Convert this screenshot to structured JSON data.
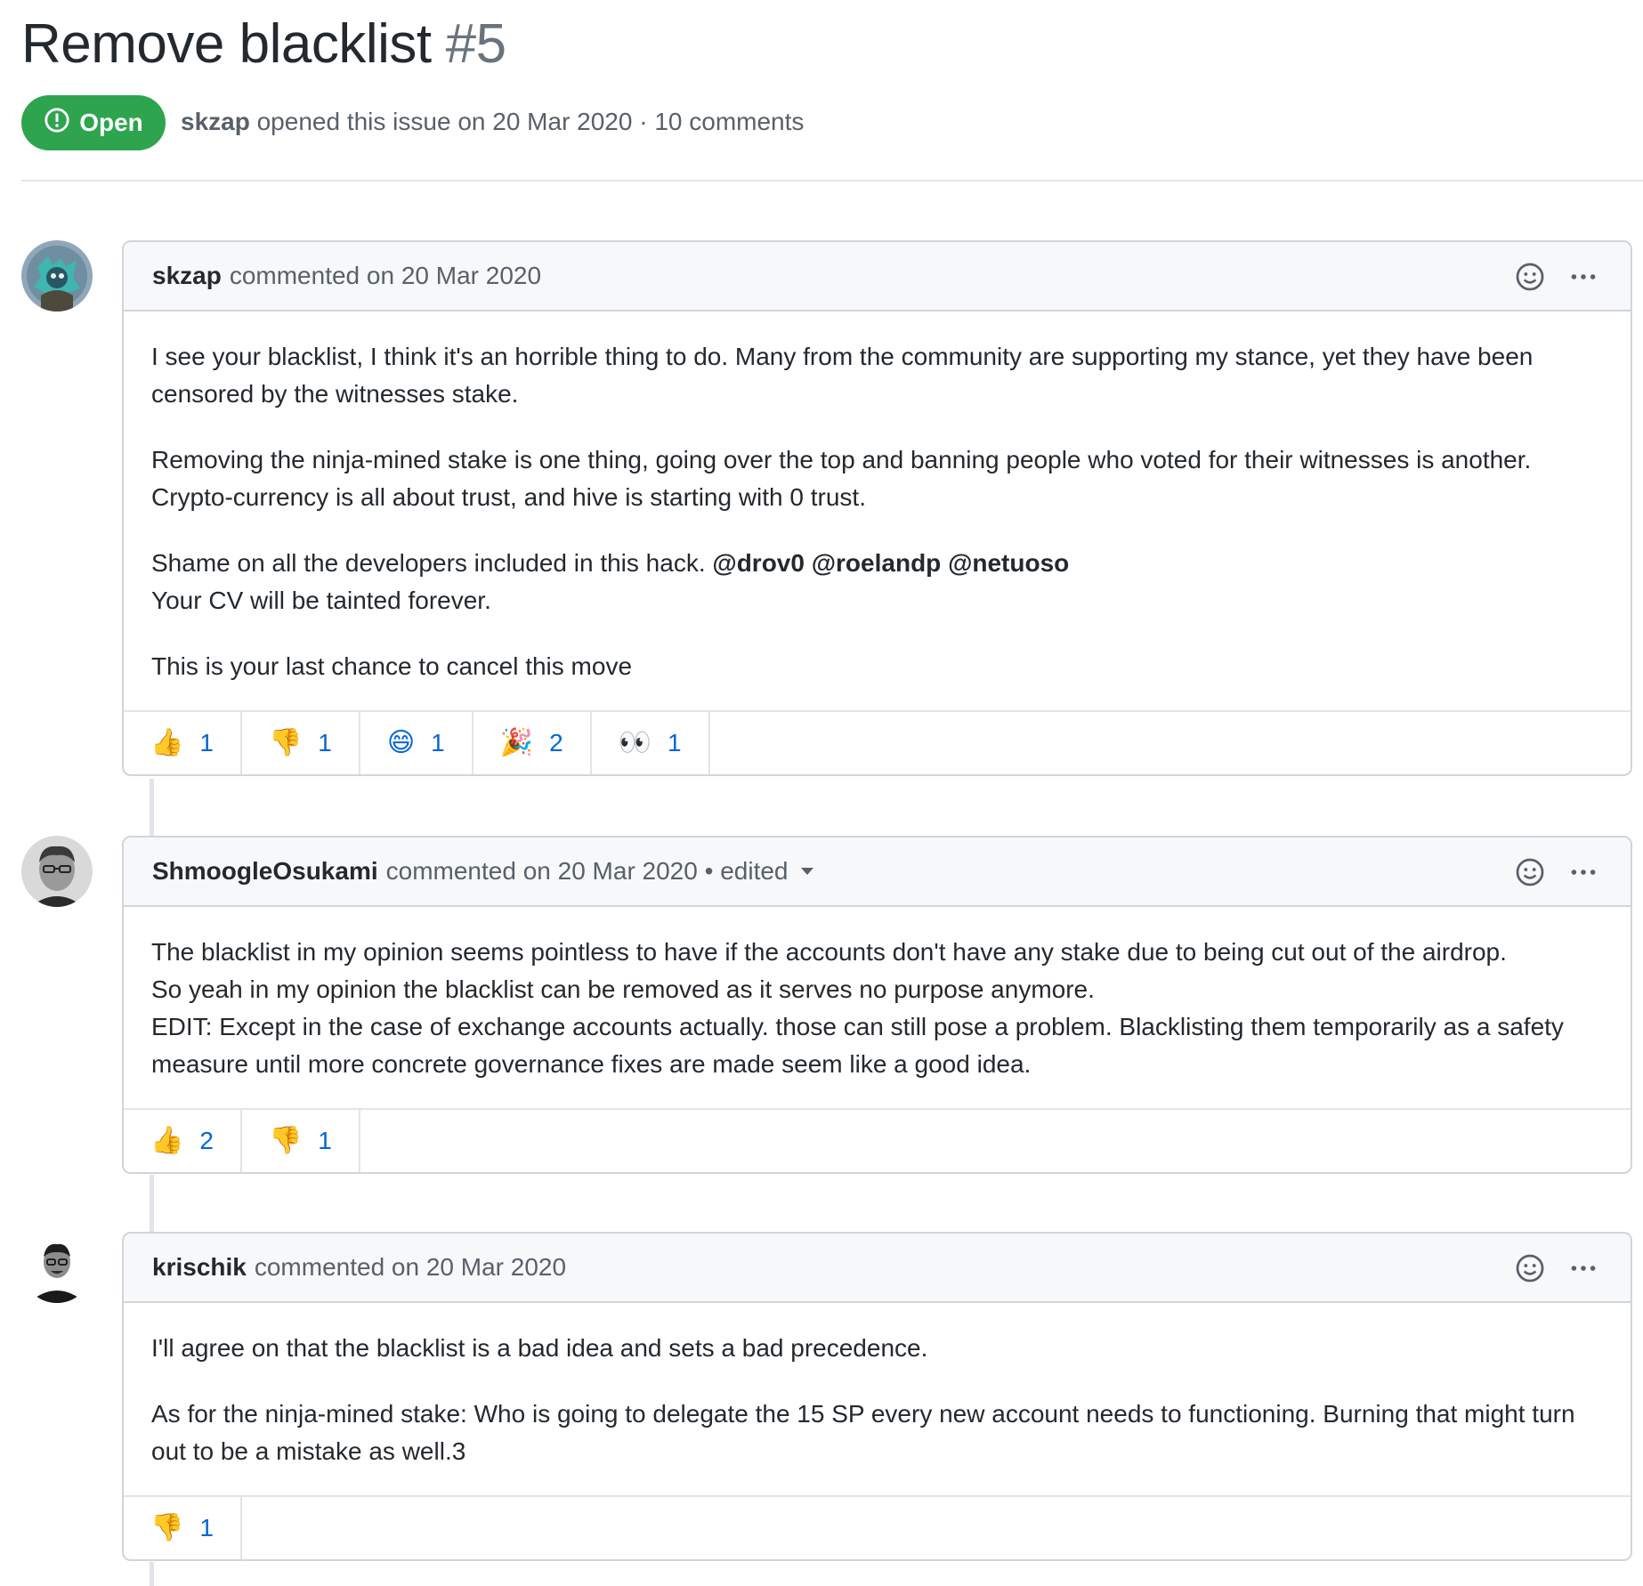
{
  "issue": {
    "title": "Remove blacklist",
    "number": "#5",
    "state": "Open",
    "author": "skzap",
    "meta_text": "opened this issue on 20 Mar 2020 · 10 comments"
  },
  "comments": [
    {
      "author": "skzap",
      "action": "commented on 20 Mar 2020",
      "edited": "",
      "paragraphs": [
        "I see your blacklist, I think it's an horrible thing to do. Many from the community are supporting my stance, yet they have been censored by the witnesses stake.",
        "Removing the ninja-mined stake is one thing, going over the top and banning people who voted for their witnesses is another. Crypto-currency is all about trust, and hive is starting with 0 trust."
      ],
      "para3_text": "Shame on all the developers included in this hack.",
      "mentions": [
        "@drov0",
        "@roelandp",
        "@netuoso"
      ],
      "para3_line2": "Your CV will be tainted forever.",
      "para4": "This is your last chance to cancel this move",
      "reactions": [
        {
          "emoji": "👍",
          "count": "1"
        },
        {
          "emoji": "👎",
          "count": "1"
        },
        {
          "emoji": "😄",
          "count": "1"
        },
        {
          "emoji": "🎉",
          "count": "2"
        },
        {
          "emoji": "👀",
          "count": "1"
        }
      ]
    },
    {
      "author": "ShmoogleOsukami",
      "action": "commented on 20 Mar 2020",
      "edited": "• edited",
      "body_lines": [
        "The blacklist in my opinion seems pointless to have if the accounts don't have any stake due to being cut out of the airdrop.",
        "So yeah in my opinion the blacklist can be removed as it serves no purpose anymore.",
        "EDIT: Except in the case of exchange accounts actually. those can still pose a problem. Blacklisting them temporarily as a safety measure until more concrete governance fixes are made seem like a good idea."
      ],
      "reactions": [
        {
          "emoji": "👍",
          "count": "2"
        },
        {
          "emoji": "👎",
          "count": "1"
        }
      ]
    },
    {
      "author": "krischik",
      "action": "commented on 20 Mar 2020",
      "edited": "",
      "paragraphs": [
        "I'll agree on that the blacklist is a bad idea and sets a bad precedence.",
        "As for the ninja-mined stake: Who is going to delegate the 15 SP every new account needs to functioning. Burning that might turn out to be a mistake as well.3"
      ],
      "reactions": [
        {
          "emoji": "👎",
          "count": "1"
        }
      ]
    }
  ]
}
